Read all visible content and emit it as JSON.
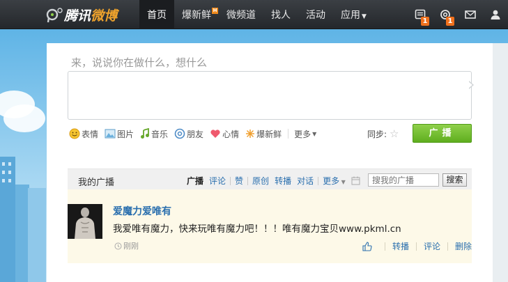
{
  "header": {
    "logo_text_white": "腾讯",
    "logo_text_orange": "微博",
    "nav": [
      {
        "label": "首页",
        "active": true
      },
      {
        "label": "爆新鲜",
        "badge": "H"
      },
      {
        "label": "微频道"
      },
      {
        "label": "找人"
      },
      {
        "label": "活动"
      },
      {
        "label": "应用",
        "dropdown": true
      }
    ],
    "icons": [
      {
        "name": "messages-icon",
        "count": "1"
      },
      {
        "name": "mentions-icon",
        "count": "1"
      },
      {
        "name": "mail-icon"
      },
      {
        "name": "profile-icon"
      }
    ]
  },
  "composer": {
    "prompt": "来，说说你在做什么，想什么",
    "value": "",
    "tools": [
      {
        "icon": "emoji-icon",
        "label": "表情"
      },
      {
        "icon": "image-icon",
        "label": "图片"
      },
      {
        "icon": "music-icon",
        "label": "音乐"
      },
      {
        "icon": "at-icon",
        "label": "朋友"
      },
      {
        "icon": "heart-icon",
        "label": "心情"
      },
      {
        "icon": "trending-icon",
        "label": "爆新鲜"
      }
    ],
    "more_label": "更多",
    "sync_label": "同步:",
    "submit_label": "广播"
  },
  "feed": {
    "title": "我的广播",
    "filters": [
      "广播",
      "评论",
      "赞",
      "原创",
      "转播",
      "对话"
    ],
    "active_filter": "广播",
    "more_label": "更多",
    "search_placeholder": "搜我的广播",
    "search_button": "搜索"
  },
  "post": {
    "author": "爱魔力爱唯有",
    "content": "我爱唯有魔力，快来玩唯有魔力吧！！！唯有魔力宝贝www.pkml.cn",
    "time": "刚刚",
    "actions": [
      "转播",
      "评论",
      "删除"
    ]
  },
  "colors": {
    "topbar": "#2b2e32",
    "accent_green": "#6dbb2c",
    "link_blue": "#2a6fae",
    "badge_orange": "#f0701c",
    "post_bg": "#fdf9e8"
  }
}
